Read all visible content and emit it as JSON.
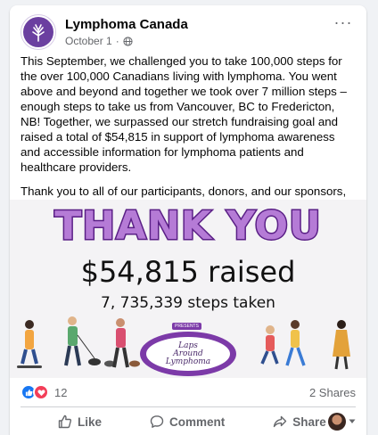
{
  "post": {
    "page_name": "Lymphoma Canada",
    "date": "October 1",
    "separator": "·",
    "paragraphs": [
      "This September, we challenged you to take 100,000 steps for the over 100,000 Canadians living with lymphoma. You went above and beyond and together we took over 7 million steps – enough steps to take us from Vancouver, BC to Fredericton, NB! Together, we surpassed our stretch fundraising goal and raised a total of $54,815 in support of lymphoma awareness and accessible information for lymphoma patients and healthcare providers.",
      "Thank you to all of our participants, donors, and our sponsors, Teva and DPM Energy, for making our inaugural Laps Around Lymphoma such a great success."
    ]
  },
  "banner": {
    "headline": "THANK YOU",
    "raised": "$54,815 raised",
    "steps": "7, 735,339 steps taken",
    "presents": "PRESENTS",
    "logo_line1": "Laps",
    "logo_line2": "Around",
    "logo_line3": "Lymphoma"
  },
  "stats": {
    "reaction_count": "12",
    "shares": "2 Shares"
  },
  "actions": {
    "like": "Like",
    "comment": "Comment",
    "share": "Share"
  },
  "colors": {
    "accent_purple": "#6b3fa0",
    "like_blue": "#1877f2",
    "love_red": "#f33e58"
  },
  "icons": [
    "globe-icon",
    "more-icon",
    "like-icon",
    "comment-icon",
    "share-icon",
    "chevron-down-icon"
  ]
}
